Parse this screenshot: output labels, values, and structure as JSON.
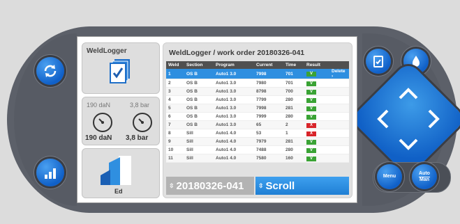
{
  "tiles": {
    "weldlogger_label": "WeldLogger",
    "gauge_left_top": "190 daN",
    "gauge_right_top": "3,8 bar",
    "gauge_left_bottom": "190 daN",
    "gauge_right_bottom": "3,8 bar",
    "ed_label": "Ed"
  },
  "main": {
    "title": "WeldLogger / work order 20180326-041",
    "columns": [
      "Weld",
      "Section",
      "Program",
      "Current",
      "Time",
      "Result"
    ],
    "rows": [
      {
        "weld": "1",
        "section": "OS B",
        "program": "Auto1 3.0",
        "current": "7998",
        "time": "701",
        "result": "V",
        "status": "ok",
        "action": "Delete"
      },
      {
        "weld": "2",
        "section": "OS B",
        "program": "Auto1 3.0",
        "current": "7980",
        "time": "701",
        "result": "V",
        "status": "ok",
        "action": ""
      },
      {
        "weld": "3",
        "section": "OS B",
        "program": "Auto1 3.0",
        "current": "8798",
        "time": "700",
        "result": "V",
        "status": "ok",
        "action": ""
      },
      {
        "weld": "4",
        "section": "OS B",
        "program": "Auto1 3.0",
        "current": "7799",
        "time": "280",
        "result": "V",
        "status": "ok",
        "action": ""
      },
      {
        "weld": "5",
        "section": "OS B",
        "program": "Auto1 3.0",
        "current": "7998",
        "time": "281",
        "result": "V",
        "status": "ok",
        "action": ""
      },
      {
        "weld": "6",
        "section": "OS B",
        "program": "Auto1 3.0",
        "current": "7999",
        "time": "280",
        "result": "V",
        "status": "ok",
        "action": ""
      },
      {
        "weld": "7",
        "section": "OS B",
        "program": "Auto1 3.0",
        "current": "65",
        "time": "2",
        "result": "X",
        "status": "bad",
        "action": ""
      },
      {
        "weld": "8",
        "section": "Sill",
        "program": "Auto1 4.0",
        "current": "53",
        "time": "1",
        "result": "X",
        "status": "bad",
        "action": ""
      },
      {
        "weld": "9",
        "section": "Sill",
        "program": "Auto1 4.0",
        "current": "7979",
        "time": "281",
        "result": "V",
        "status": "ok",
        "action": ""
      },
      {
        "weld": "10",
        "section": "Sill",
        "program": "Auto1 4.0",
        "current": "7488",
        "time": "280",
        "result": "V",
        "status": "ok",
        "action": ""
      },
      {
        "weld": "11",
        "section": "Sill",
        "program": "Auto1 4.0",
        "current": "7580",
        "time": "160",
        "result": "V",
        "status": "ok",
        "action": ""
      }
    ],
    "footer_value": "20180326-041",
    "footer_scroll": "Scroll"
  },
  "buttons": {
    "menu": "Menu",
    "auto": "Auto",
    "man": "Man"
  },
  "icons": [
    "refresh-icon",
    "signal-bars-icon",
    "document-check-icon",
    "water-drop-icon",
    "clipboard-check-icon",
    "gauge-icon",
    "chart-icon"
  ],
  "colors": {
    "accent": "#1f7fd4",
    "ok": "#3aa335",
    "bad": "#d8242a",
    "panel": "#5c6069"
  }
}
